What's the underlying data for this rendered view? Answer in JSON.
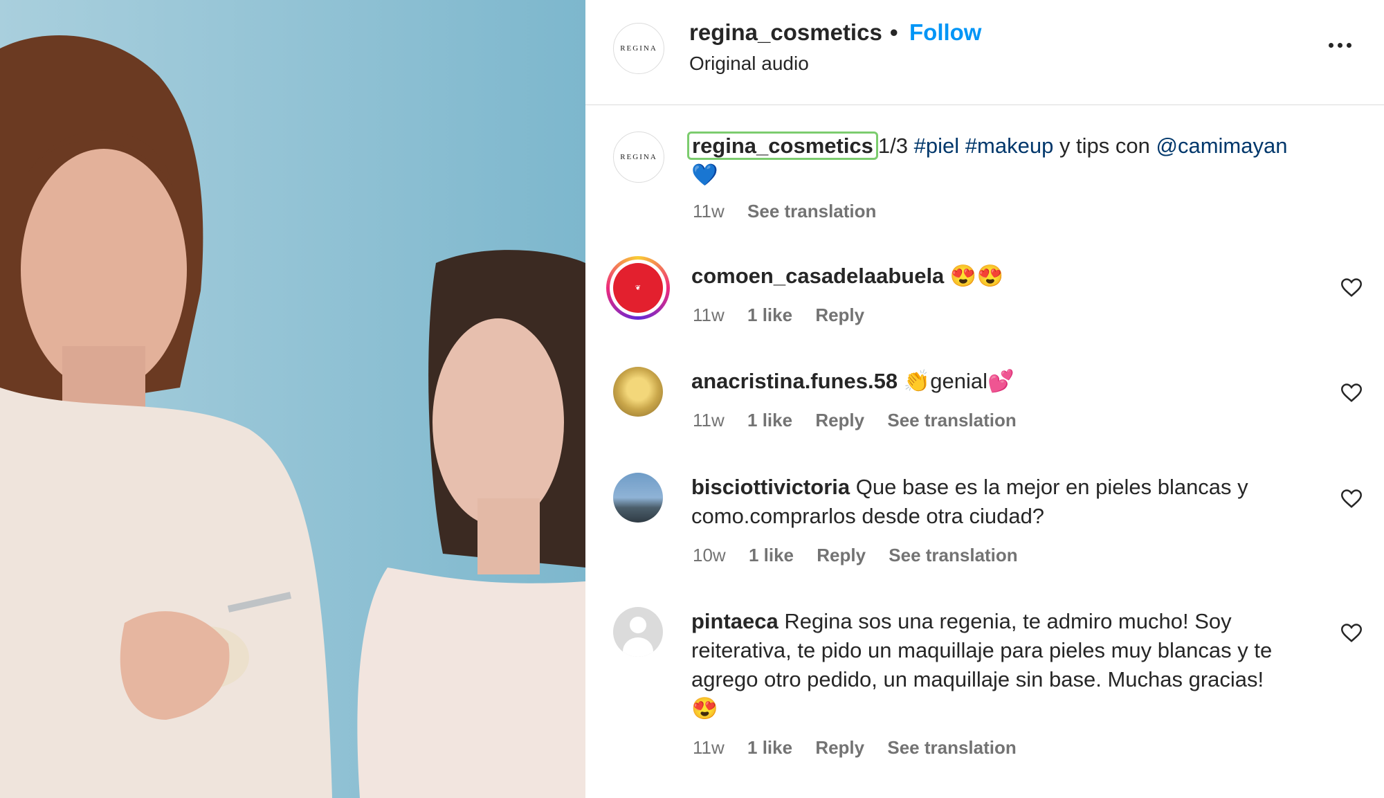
{
  "post": {
    "username": "regina_cosmetics",
    "separator": "•",
    "follow_label": "Follow",
    "audio_label": "Original audio",
    "avatar_text": "REGINA",
    "more_icon": "more-horizontal-icon"
  },
  "caption": {
    "username": "regina_cosmetics",
    "counter": "1/3",
    "tag1": "#piel",
    "tag2": "#makeup",
    "middle": "y tips con",
    "mention": "@camimayan",
    "emoji": "💙",
    "time": "11w",
    "translate": "See translation"
  },
  "comments": [
    {
      "username": "comoen_casadelaabuela",
      "text": "😍😍",
      "time": "11w",
      "likes": "1 like",
      "reply": "Reply",
      "translate": ""
    },
    {
      "username": "anacristina.funes.58",
      "text": "👏genial💕",
      "time": "11w",
      "likes": "1 like",
      "reply": "Reply",
      "translate": "See translation"
    },
    {
      "username": "bisciottivictoria",
      "text": "Que base es la mejor en pieles blancas y como.comprarlos desde otra ciudad?",
      "time": "10w",
      "likes": "1 like",
      "reply": "Reply",
      "translate": "See translation"
    },
    {
      "username": "pintaeca",
      "text": "Regina sos una regenia, te admiro mucho! Soy reiterativa, te pido un maquillaje para pieles muy blancas y te agrego otro pedido, un maquillaje sin base. Muchas gracias! 😍",
      "time": "11w",
      "likes": "1 like",
      "reply": "Reply",
      "translate": "See translation"
    }
  ],
  "colors": {
    "accent": "#0095f6",
    "hashtag": "#00376b",
    "muted": "#737373",
    "highlight": "#7ccc6e"
  }
}
